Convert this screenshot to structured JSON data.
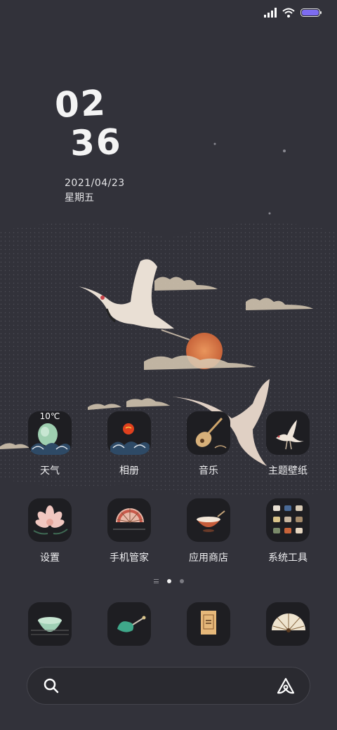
{
  "status_bar": {
    "signal_icon": "signal-bars-icon",
    "wifi_icon": "wifi-icon",
    "battery_icon": "battery-icon",
    "battery_color": "#7d6cf0"
  },
  "clock": {
    "hours": "02",
    "minutes": "36"
  },
  "date": {
    "date": "2021/04/23",
    "weekday": "星期五"
  },
  "apps_row1": [
    {
      "label": "天气",
      "icon": "weather-icon",
      "badge": "10℃"
    },
    {
      "label": "相册",
      "icon": "gallery-icon"
    },
    {
      "label": "音乐",
      "icon": "music-icon"
    },
    {
      "label": "主题壁纸",
      "icon": "themes-icon"
    }
  ],
  "apps_row2": [
    {
      "label": "设置",
      "icon": "settings-icon"
    },
    {
      "label": "手机管家",
      "icon": "security-icon"
    },
    {
      "label": "应用商店",
      "icon": "app-store-icon"
    },
    {
      "label": "系统工具",
      "icon": "system-tools-folder-icon"
    }
  ],
  "dock": [
    {
      "icon": "phone-icon"
    },
    {
      "icon": "messages-icon"
    },
    {
      "icon": "browser-icon"
    },
    {
      "icon": "camera-icon"
    }
  ],
  "page_indicator": {
    "pages": 2,
    "current": 1
  },
  "search": {
    "search_icon": "search-icon",
    "assistant_icon": "assistant-icon"
  },
  "colors": {
    "background": "#32323a",
    "icon_bg": "#1e1e22",
    "sun": "#d9773f"
  }
}
